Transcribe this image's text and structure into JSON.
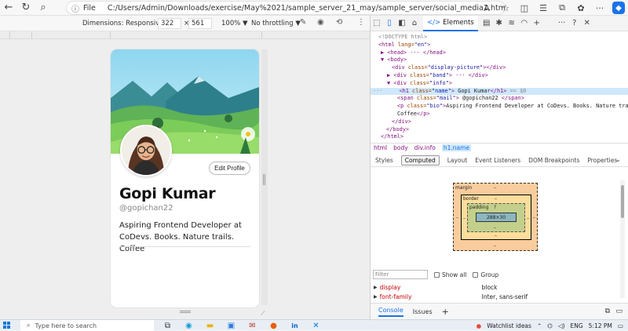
{
  "browser": {
    "file_label": "File",
    "url": "C:/Users/Admin/Downloads/exercise/May%2021/sample_server_21_may/sample_server/social_media1.html",
    "read_aloud": "A"
  },
  "device_toolbar": {
    "dimensions_label": "Dimensions: Responsive",
    "width": "322",
    "times": "×",
    "height": "561",
    "zoom": "100%",
    "throttle": "No throttling"
  },
  "profile": {
    "edit_label": "Edit Profile",
    "name": "Gopi Kumar",
    "handle": "@gopichan22",
    "bio": "Aspiring Frontend Developer at CoDevs. Books. Nature trails. Coffee"
  },
  "devtools": {
    "elements_tab": "Elements",
    "dom_lines": {
      "l1": "<!DOCTYPE html>",
      "l2a": "<html",
      "l2b": " lang=",
      "l2c": "\"en\"",
      "l2d": ">",
      "l3": "▶ <head> ··· </head>",
      "l4": "▼ <body>",
      "l5a": "<div",
      "l5b": " class=",
      "l5c": "\"display-picture\"",
      "l5d": "></div>",
      "l6a": "▶ <div",
      "l6b": " class=",
      "l6c": "\"band\"",
      "l6d": "> ··· </div>",
      "l7a": "▼ <div",
      "l7b": " class=",
      "l7c": "\"info\"",
      "l7d": ">",
      "l8a": "<h1",
      "l8b": " class=",
      "l8c": "\"name\"",
      "l8d": ">",
      "l8e": " Gopi Kumar",
      "l8f": "</h1>",
      "l8g": " == $0",
      "l9a": "<span",
      "l9b": " class=",
      "l9c": "\"mail\"",
      "l9d": ">",
      "l9e": " @gopichan22 ",
      "l9f": "</span>",
      "l10a": "<p",
      "l10b": " class=",
      "l10c": "\"bio\"",
      "l10d": ">",
      "l10e": "Aspiring Frontend Developer at CoDevs. Books. Nature trails.",
      "l11a": "Coffee",
      "l11b": "</p>",
      "l12": "</div>",
      "l13": "</body>",
      "l14": "</html>",
      "ellipsis": "···"
    },
    "breadcrumbs": [
      "html",
      "body",
      "div.info",
      "h1.name"
    ],
    "subtabs": [
      "Styles",
      "Computed",
      "Layout",
      "Event Listeners",
      "DOM Breakpoints",
      "Properties"
    ],
    "box": {
      "margin_label": "margin",
      "margin_val": "–",
      "border_label": "border",
      "border_val": "–",
      "padding_label": "padding",
      "padding_val": "?",
      "content": "288×30",
      "dash": "–"
    },
    "filter_placeholder": "Filter",
    "show_all": "Show all",
    "group": "Group",
    "props": [
      {
        "name": "display",
        "value": "block"
      },
      {
        "name": "font-family",
        "value": "Inter, sans-serif"
      }
    ],
    "drawer": {
      "console": "Console",
      "issues": "Issues",
      "plus": "+"
    }
  },
  "taskbar": {
    "search_placeholder": "Type here to search",
    "watchlist": "Watchlist ideas",
    "lang": "ENG",
    "time": "5:12 PM"
  }
}
